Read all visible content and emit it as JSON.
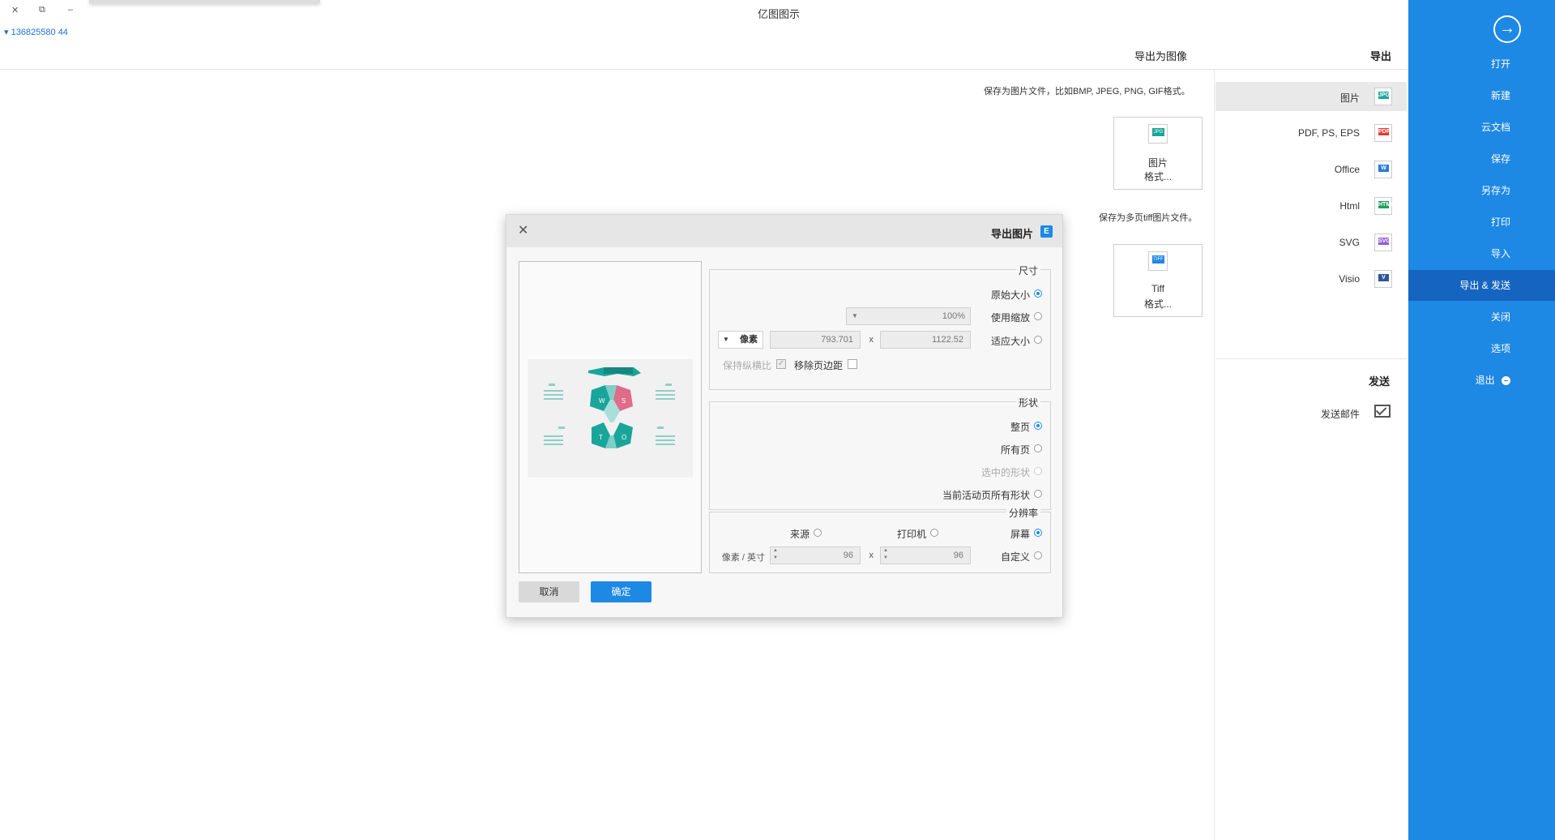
{
  "window": {
    "title": "亿图图示",
    "account": "136825580 44",
    "minimize": "–",
    "restore": "⧉",
    "close": "✕"
  },
  "nav": {
    "back_icon": "→",
    "items": [
      "打开",
      "新建",
      "云文档",
      "保存",
      "另存为",
      "打印",
      "导入",
      "导出 & 发送",
      "关闭",
      "选项",
      "退出"
    ],
    "active": "导出 & 发送"
  },
  "export_panel": {
    "heading": "导出",
    "formats": [
      {
        "icon": "JPG",
        "label": "图片",
        "color": "#1aa59a"
      },
      {
        "icon": "PDF",
        "label": "PDF, PS, EPS",
        "color": "#e53935"
      },
      {
        "icon": "W",
        "label": "Office",
        "color": "#2b7cd3"
      },
      {
        "icon": "HTML",
        "label": "Html",
        "color": "#20a060"
      },
      {
        "icon": "SVG",
        "label": "SVG",
        "color": "#8e5cd9"
      },
      {
        "icon": "V",
        "label": "Visio",
        "color": "#2b5797"
      }
    ],
    "send_heading": "发送",
    "send_mail": "发送邮件"
  },
  "content": {
    "title": "导出为图像",
    "desc1": "保存为图片文件，比如BMP, JPEG, PNG, GIF格式。",
    "card1": {
      "icon": "JPG",
      "line1": "图片",
      "line2": "格式..."
    },
    "desc2": "保存为多页tiff图片文件。",
    "card2": {
      "icon": "TIFF",
      "line1": "Tiff",
      "line2": "格式..."
    }
  },
  "dialog": {
    "title": "导出图片",
    "logo": "E",
    "close": "✕",
    "size": {
      "legend": "尺寸",
      "original": "原始大小",
      "zoom": "使用缩放",
      "zoom_value": "100%",
      "fit": "适应大小",
      "width": "1122.52",
      "times": "x",
      "height": "793.701",
      "unit": "像素",
      "remove_margin": "移除页边距",
      "keep_ratio": "保持纵横比"
    },
    "shape": {
      "legend": "形状",
      "whole_page": "整页",
      "all_pages": "所有页",
      "selected": "选中的形状",
      "current_all": "当前活动页所有形状"
    },
    "resolution": {
      "legend": "分辨率",
      "screen": "屏幕",
      "printer": "打印机",
      "source": "来源",
      "custom": "自定义",
      "x_value": "96",
      "times": "x",
      "y_value": "96",
      "unit": "像素 / 英寸"
    },
    "ok": "确定",
    "cancel": "取消",
    "preview_letters": [
      "W",
      "S",
      "T",
      "O"
    ]
  }
}
